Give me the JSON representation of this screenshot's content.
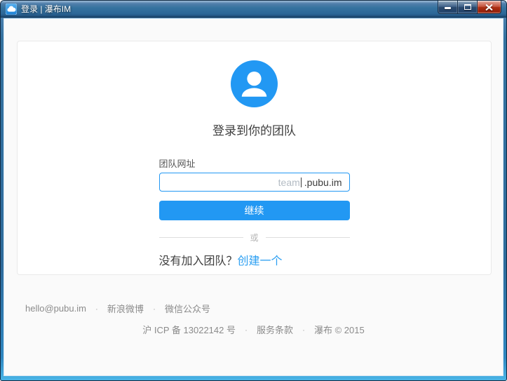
{
  "window": {
    "title": "登录 | 瀑布IM",
    "icons": {
      "app": "cloud-icon",
      "minimize": "minimize-icon",
      "maximize": "maximize-icon",
      "close": "close-icon"
    }
  },
  "main": {
    "avatar_icon": "person-icon",
    "heading": "登录到你的团队",
    "form": {
      "label": "团队网址",
      "value": "",
      "placeholder": "team",
      "domain_suffix": ".pubu.im",
      "continue_label": "继续"
    },
    "divider_text": "或",
    "signup_prompt": "没有加入团队？",
    "signup_link": "创建一个"
  },
  "footer": {
    "separator": "·",
    "email": "hello@pubu.im",
    "weibo_label": "新浪微博",
    "wechat_label": "微信公众号",
    "icp_label": "沪 ICP 备 13022142 号",
    "terms_label": "服务条款",
    "copyright": "瀑布 © 2015"
  },
  "colors": {
    "accent_blue": "#2298f3",
    "titlebar_blue": "#35729f",
    "close_button_red": "#ad3014",
    "link_blue": "#2b9ff2",
    "content_background": "#fafafa",
    "card_background": "#ffffff"
  }
}
